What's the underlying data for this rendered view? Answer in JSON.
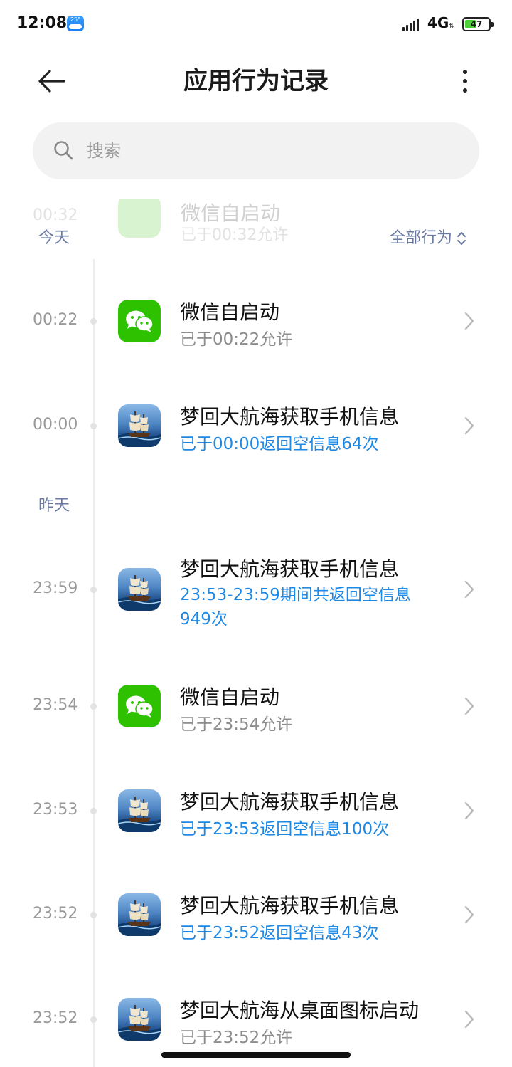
{
  "status_bar": {
    "time": "12:08",
    "weather_temp": "25°",
    "network": "4G",
    "battery": "47",
    "battery_fraction": 0.47
  },
  "header": {
    "title": "应用行为记录",
    "back_icon": "back-arrow-icon",
    "more_icon": "more-vertical-icon"
  },
  "search": {
    "placeholder": "搜索"
  },
  "ghost_row": {
    "time": "00:32",
    "title": "微信自启动",
    "subtitle": "已于00:32允许"
  },
  "filter": {
    "label": "全部行为"
  },
  "sections": {
    "today": "今天",
    "yesterday": "昨天"
  },
  "records": [
    {
      "time": "00:22",
      "app": "wechat",
      "title": "微信自启动",
      "subtitle": "已于00:22允许",
      "subtitle_color": "gray"
    },
    {
      "time": "00:00",
      "app": "game",
      "title": "梦回大航海获取手机信息",
      "subtitle": "已于00:00返回空信息64次",
      "subtitle_color": "blue"
    },
    {
      "time": "23:59",
      "app": "game",
      "title": "梦回大航海获取手机信息",
      "subtitle": "23:53-23:59期间共返回空信息",
      "subtitle_line2": "949次",
      "subtitle_color": "blue"
    },
    {
      "time": "23:54",
      "app": "wechat",
      "title": "微信自启动",
      "subtitle": "已于23:54允许",
      "subtitle_color": "gray"
    },
    {
      "time": "23:53",
      "app": "game",
      "title": "梦回大航海获取手机信息",
      "subtitle": "已于23:53返回空信息100次",
      "subtitle_color": "blue"
    },
    {
      "time": "23:52",
      "app": "game",
      "title": "梦回大航海获取手机信息",
      "subtitle": "已于23:52返回空信息43次",
      "subtitle_color": "blue"
    },
    {
      "time": "23:52",
      "app": "game",
      "title": "梦回大航海从桌面图标启动",
      "subtitle": "已于23:52允许",
      "subtitle_color": "gray"
    }
  ],
  "colors": {
    "accent_blue": "#1e88e5",
    "section_label": "#6b7aa0",
    "wechat_green": "#2dc100"
  }
}
